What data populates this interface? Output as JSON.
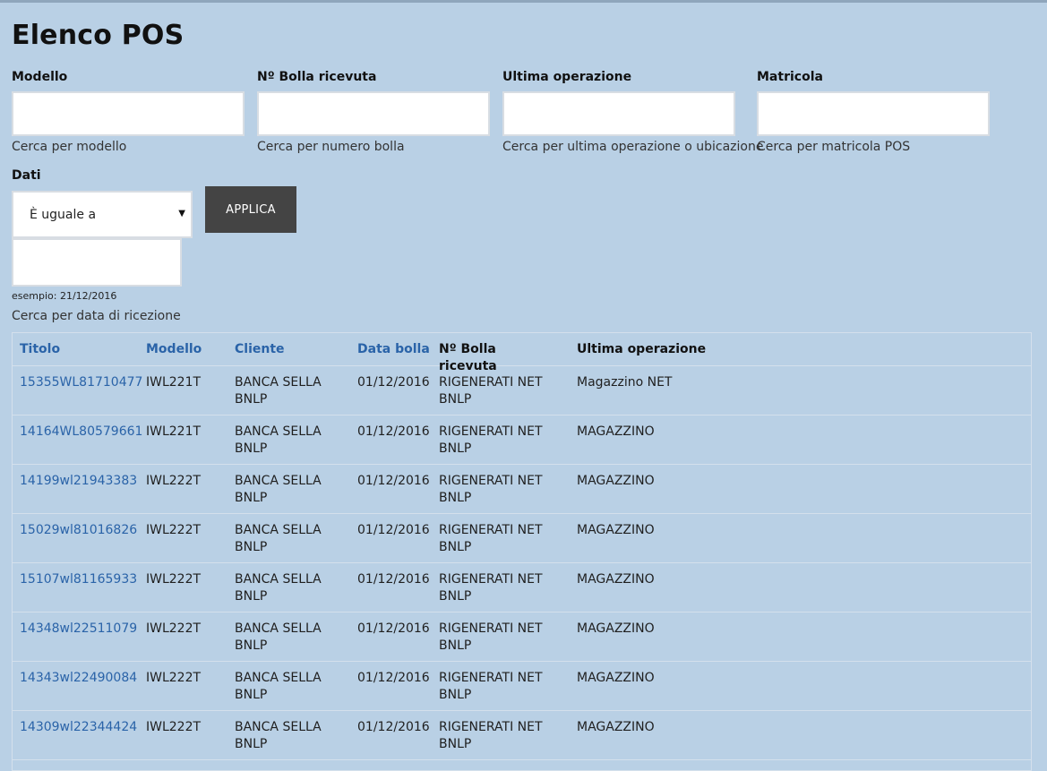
{
  "page_title": "Elenco POS",
  "filters": [
    {
      "label": "Modello",
      "hint": "Cerca per modello",
      "value": ""
    },
    {
      "label": "Nº Bolla ricevuta",
      "hint": "Cerca per numero bolla",
      "value": ""
    },
    {
      "label": "Ultima operazione",
      "hint": "Cerca per ultima operazione o ubicazione",
      "value": ""
    },
    {
      "label": "Matricola",
      "hint": "Cerca per matricola POS",
      "value": ""
    }
  ],
  "dati": {
    "label": "Dati",
    "operator": "È uguale a",
    "date_value": "",
    "example": "esempio: 21/12/2016",
    "hint": "Cerca per data di ricezione"
  },
  "apply_label": "APPLICA",
  "table": {
    "columns": [
      "Titolo",
      "Modello",
      "Cliente",
      "Data bolla",
      "Nº Bolla ricevuta",
      "Ultima operazione"
    ],
    "rows": [
      [
        "15355WL81710477",
        "IWL221T",
        "BANCA SELLA BNLP",
        "01/12/2016",
        "RIGENERATI NET BNLP",
        "Magazzino NET"
      ],
      [
        "14164WL80579661",
        "IWL221T",
        "BANCA SELLA BNLP",
        "01/12/2016",
        "RIGENERATI NET BNLP",
        "MAGAZZINO"
      ],
      [
        "14199wl21943383",
        "IWL222T",
        "BANCA SELLA BNLP",
        "01/12/2016",
        "RIGENERATI NET BNLP",
        "MAGAZZINO"
      ],
      [
        "15029wl81016826",
        "IWL222T",
        "BANCA SELLA BNLP",
        "01/12/2016",
        "RIGENERATI NET BNLP",
        "MAGAZZINO"
      ],
      [
        "15107wl81165933",
        "IWL222T",
        "BANCA SELLA BNLP",
        "01/12/2016",
        "RIGENERATI NET BNLP",
        "MAGAZZINO"
      ],
      [
        "14348wl22511079",
        "IWL222T",
        "BANCA SELLA BNLP",
        "01/12/2016",
        "RIGENERATI NET BNLP",
        "MAGAZZINO"
      ],
      [
        "14343wl22490084",
        "IWL222T",
        "BANCA SELLA BNLP",
        "01/12/2016",
        "RIGENERATI NET BNLP",
        "MAGAZZINO"
      ],
      [
        "14309wl22344424",
        "IWL222T",
        "BANCA SELLA BNLP",
        "01/12/2016",
        "RIGENERATI NET BNLP",
        "MAGAZZINO"
      ]
    ]
  }
}
